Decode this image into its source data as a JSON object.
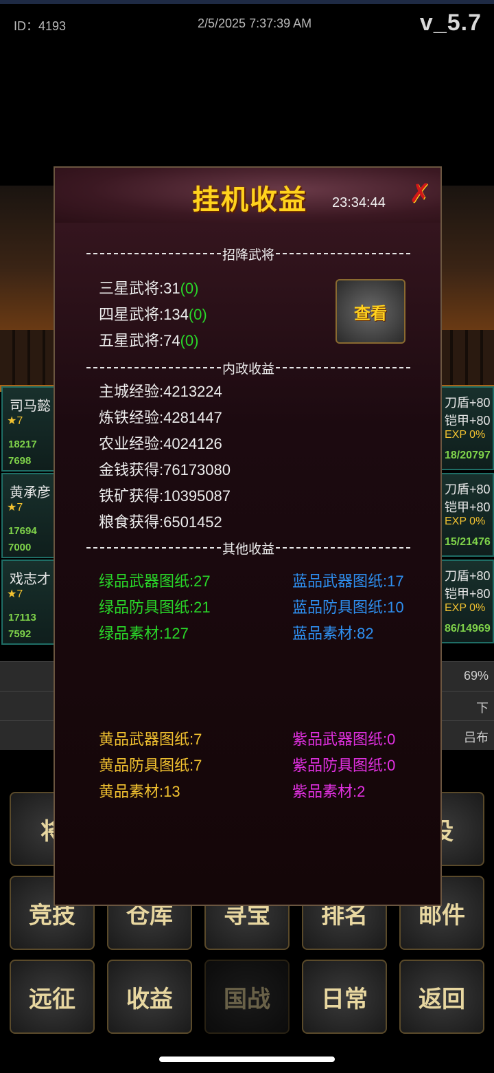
{
  "status_bar": {
    "id": "ID：4193",
    "datetime": "2/5/2025 7:37:39 AM",
    "version": "v_5.7"
  },
  "background": {
    "generals_left": [
      {
        "name": "司马懿",
        "stars": "7",
        "attack": "18217",
        "defense": "7698"
      },
      {
        "name": "黄承彦",
        "stars": "7",
        "attack": "17694",
        "defense": "7000"
      },
      {
        "name": "戏志才",
        "stars": "7",
        "attack": "17113",
        "defense": "7592"
      }
    ],
    "generals_right": [
      {
        "l1": "刀盾+80",
        "l2": "铠甲+80",
        "exp": "EXP 0%",
        "val": "18/20797"
      },
      {
        "l1": "刀盾+80",
        "l2": "铠甲+80",
        "exp": "EXP 0%",
        "val": "15/21476"
      },
      {
        "l1": "刀盾+80",
        "l2": "铠甲+80",
        "exp": "EXP 0%",
        "val": "86/14969"
      }
    ],
    "bar_rows": [
      "69%",
      "下",
      "吕布"
    ],
    "buttons": [
      "将",
      "役",
      "竞技",
      "仓库",
      "寻宝",
      "排名",
      "邮件",
      "远征",
      "收益",
      "国战",
      "日常",
      "返回"
    ]
  },
  "modal": {
    "title": "挂机收益",
    "timer": "23:34:44",
    "view_label": "查看",
    "sections": {
      "recruit": "招降武将",
      "domestic": "内政收益",
      "other": "其他收益"
    },
    "recruit": [
      {
        "label": "三星武将:31",
        "extra": "(0)"
      },
      {
        "label": "四星武将:134",
        "extra": "(0)"
      },
      {
        "label": "五星武将:74",
        "extra": "(0)"
      }
    ],
    "domestic": [
      "主城经验:4213224",
      "炼铁经验:4281447",
      "农业经验:4024126",
      "金钱获得:76173080",
      "铁矿获得:10395087",
      "粮食获得:6501452"
    ],
    "other_top": {
      "green": [
        "绿品武器图纸:27",
        "绿品防具图纸:21",
        "绿品素材:127"
      ],
      "blue": [
        "蓝品武器图纸:17",
        "蓝品防具图纸:10",
        "蓝品素材:82"
      ]
    },
    "other_bottom": {
      "yellow": [
        "黄品武器图纸:7",
        "黄品防具图纸:7",
        "黄品素材:13"
      ],
      "purple": [
        "紫品武器图纸:0",
        "紫品防具图纸:0",
        "紫品素材:2"
      ]
    }
  }
}
